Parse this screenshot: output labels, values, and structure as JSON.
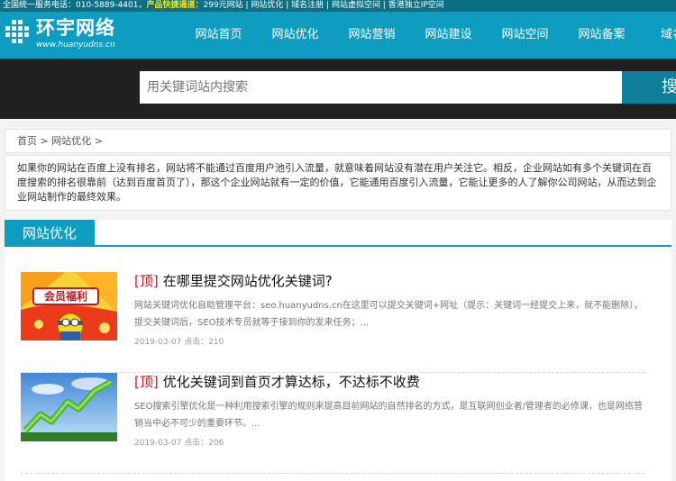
{
  "topbar": {
    "hotline": "全国统一服务电话：010-5889-4401，",
    "express_label": "产品快捷通道：",
    "links": "299元网站 | 网站优化 | 域名注册 | 网站虚拟空间 | 香港独立IP空间"
  },
  "logo": {
    "title": "环宇网络",
    "url": "www.huanyudns.cn",
    "icon": "grid-dots-icon"
  },
  "nav": [
    "网站首页",
    "网站优化",
    "网站营销",
    "网站建设",
    "网站空间",
    "网站备案",
    "域名注"
  ],
  "search": {
    "placeholder": "用关键词站内搜索",
    "button": "搜索"
  },
  "breadcrumb": {
    "home": "首页",
    "sep1": " > ",
    "cat": "网站优化",
    "sep2": " >"
  },
  "intro": "如果你的网站在百度上没有排名，网站将不能通过百度用户池引入流量，就意味着网站没有潜在用户关注它。相反，企业网站如有多个关键词在百度搜索的排名很靠前（达到百度首页了），那这个企业网站就有一定的价值，它能通用百度引入流量，它能让更多的人了解你公司网站，从而达到企业网站制作的最终效果。",
  "section_title": "网站优化",
  "posts": [
    {
      "tag": "[顶]",
      "title": "在哪里提交网站优化关键词?",
      "excerpt": "网站关键词优化自助管理平台：seo.huanyudns.cn在这里可以提交关键词+网址（提示：关键词一经提交上来，就不能删除），提交关键词后，SEO技术专员就等于接到你的发来任务；...",
      "date": "2019-03-07",
      "clicks": "点击：210",
      "thumb_text": "会员福利"
    },
    {
      "tag": "[顶]",
      "title": "优化关键词到首页才算达标，不达标不收费",
      "excerpt": "SEO搜索引擎优化是一种利用搜索引擎的规则来提高目前网站的自然排名的方式，是互联网创业者/管理者的必修课，也是网络营销当中必不可少的重要环节。...",
      "date": "2019-03-07",
      "clicks": "点击：206",
      "thumb_text": ""
    }
  ],
  "colors": {
    "brand": "#0f9cc1",
    "topbar": "#0c6f86",
    "search_band": "#202020",
    "tag_red": "#d21b1b"
  }
}
